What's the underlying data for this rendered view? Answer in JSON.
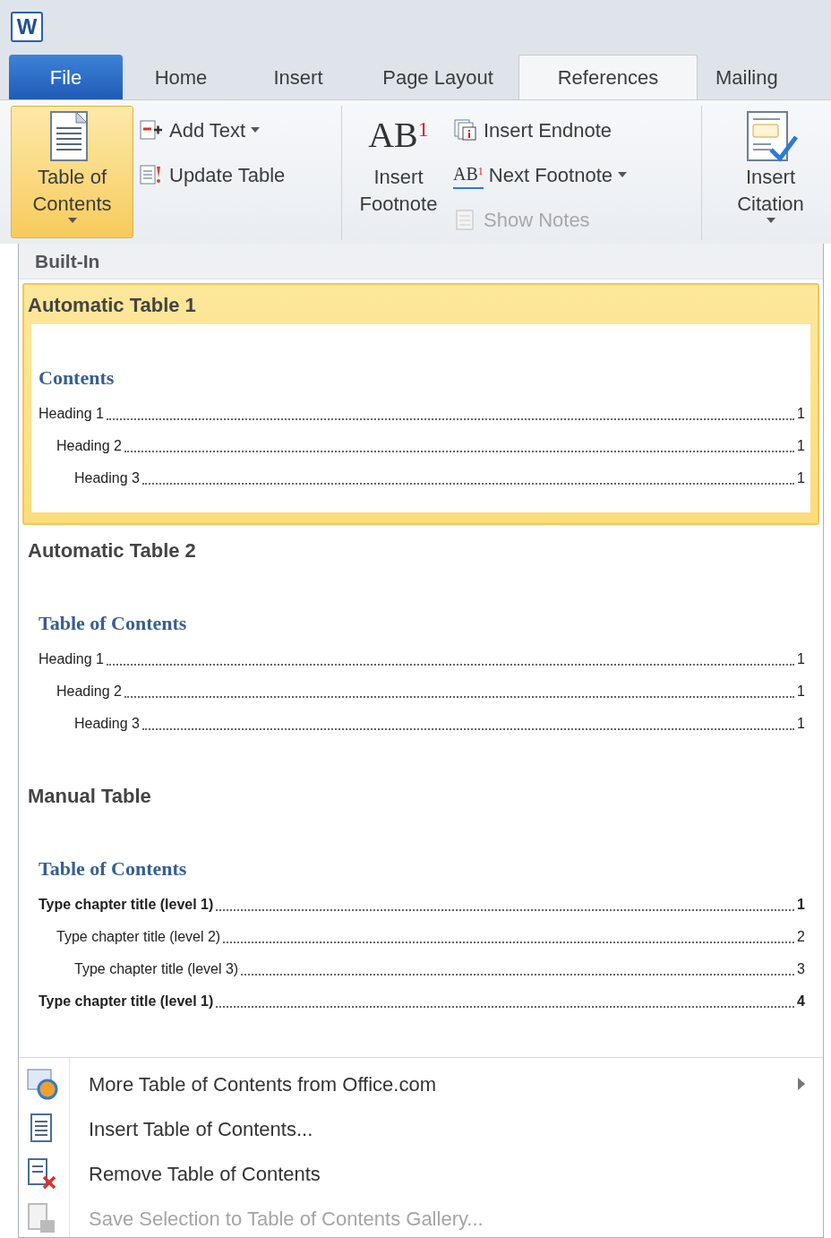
{
  "app_icon": "W",
  "tabs": [
    {
      "label": "File",
      "kind": "file",
      "selected": false
    },
    {
      "label": "Home",
      "kind": "tab",
      "selected": false
    },
    {
      "label": "Insert",
      "kind": "tab",
      "selected": false
    },
    {
      "label": "Page Layout",
      "kind": "tab",
      "selected": false
    },
    {
      "label": "References",
      "kind": "tab",
      "selected": true
    },
    {
      "label": "Mailing",
      "kind": "tab",
      "selected": false
    }
  ],
  "ribbon_groups": [
    {
      "items": [
        {
          "kind": "large",
          "label": "Table of Contents",
          "dropdown": true,
          "pressed": true
        },
        {
          "kind": "small",
          "label": "Add Text",
          "dropdown": true
        },
        {
          "kind": "small",
          "label": "Update Table",
          "dropdown": false
        }
      ]
    },
    {
      "items": [
        {
          "kind": "large",
          "icon_text": "AB$^{1}$",
          "label": "Insert Footnote",
          "dropdown": false,
          "pressed": false
        },
        {
          "kind": "small",
          "label": "Insert Endnote",
          "dropdown": false
        },
        {
          "kind": "small",
          "icon_text": "AB$^{1}$",
          "label": "Next Footnote",
          "dropdown": true
        },
        {
          "kind": "small",
          "label": "Show Notes",
          "dropdown": false,
          "disabled": true
        }
      ]
    },
    {
      "items": [
        {
          "kind": "large",
          "label": "Insert Citation",
          "dropdown": true,
          "pressed": false
        }
      ]
    }
  ],
  "gallery": {
    "section": "Built-In",
    "items": [
      {
        "title": "Automatic Table 1",
        "selected": true,
        "heading": "Contents",
        "entries": [
          {
            "text": "Heading 1",
            "page": "1",
            "bold": false,
            "children": [
              {
                "text": "Heading 2",
                "page": "1",
                "bold": false,
                "children": [
                  {
                    "text": "Heading 3",
                    "page": "1",
                    "bold": false
                  }
                ]
              }
            ]
          }
        ]
      },
      {
        "title": "Automatic Table 2",
        "selected": false,
        "heading": "Table of Contents",
        "entries": [
          {
            "text": "Heading 1",
            "page": "1",
            "bold": false,
            "children": [
              {
                "text": "Heading 2",
                "page": "1",
                "bold": false,
                "children": [
                  {
                    "text": "Heading 3",
                    "page": "1",
                    "bold": false
                  }
                ]
              }
            ]
          }
        ]
      },
      {
        "title": "Manual Table",
        "selected": false,
        "heading": "Table of Contents",
        "entries": [
          {
            "text": "Type chapter title (level 1)",
            "page": "1",
            "bold": true,
            "children": [
              {
                "text": "Type chapter title (level 2)",
                "page": "2",
                "bold": false,
                "children": [
                  {
                    "text": "Type chapter title (level 3)",
                    "page": "3",
                    "bold": false
                  }
                ]
              }
            ]
          },
          {
            "text": "Type chapter title (level 1)",
            "page": "4",
            "bold": true
          }
        ]
      }
    ]
  },
  "menu": [
    {
      "label": "More Table of Contents from Office.com",
      "submenu": true,
      "disabled": false
    },
    {
      "label": "Insert Table of Contents...",
      "submenu": false,
      "disabled": false
    },
    {
      "label": "Remove Table of Contents",
      "submenu": false,
      "disabled": false
    },
    {
      "label": "Save Selection to Table of Contents Gallery...",
      "submenu": false,
      "disabled": true
    }
  ]
}
